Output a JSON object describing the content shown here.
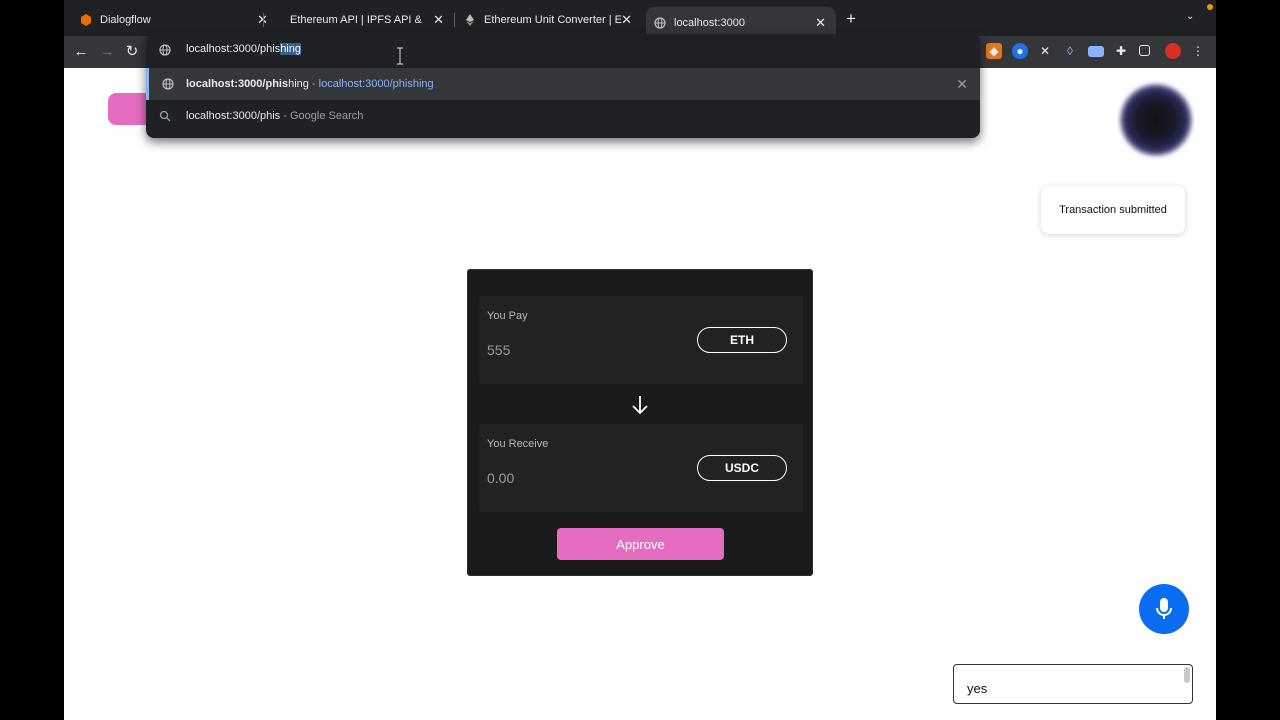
{
  "browser": {
    "tabs": [
      {
        "title": "Dialogflow",
        "favicon": "dialogflow-icon",
        "active": false
      },
      {
        "title": "Ethereum API | IPFS API & Gat",
        "favicon": "infura-icon",
        "active": false
      },
      {
        "title": "Ethereum Unit Converter | Eth",
        "favicon": "ethereum-icon",
        "active": false
      },
      {
        "title": "localhost:3000",
        "favicon": "globe-icon",
        "active": true
      }
    ],
    "address_bar": {
      "typed": "localhost:3000/phis",
      "autocomplete": "hing"
    },
    "suggestions": [
      {
        "bold": "localhost:3000/phis",
        "rest": "hing",
        "separator": " - ",
        "url": "localhost:3000/phishing",
        "icon": "globe-icon"
      },
      {
        "text": "localhost:3000/phis",
        "separator": " - ",
        "hint": "Google Search",
        "icon": "search-icon"
      }
    ],
    "extensions": [
      "metamask-icon",
      "extension-blue-icon",
      "extension-x-icon",
      "drop-icon",
      "window-icon",
      "puzzle-icon",
      "sidepanel-icon",
      "avatar-icon",
      "kebab-menu-icon"
    ]
  },
  "page": {
    "toast": "Transaction submitted",
    "swap": {
      "pay": {
        "label": "You Pay",
        "amount": "555",
        "token": "ETH"
      },
      "receive": {
        "label": "You Receive",
        "amount": "0.00",
        "token": "USDC"
      },
      "approve_label": "Approve"
    },
    "chat_input": {
      "value": "yes"
    }
  },
  "colors": {
    "accent_pink": "#e56cc0",
    "mic_blue": "#0a6cf0",
    "chrome_dark": "#202124",
    "link_blue": "#8ab4f8"
  }
}
